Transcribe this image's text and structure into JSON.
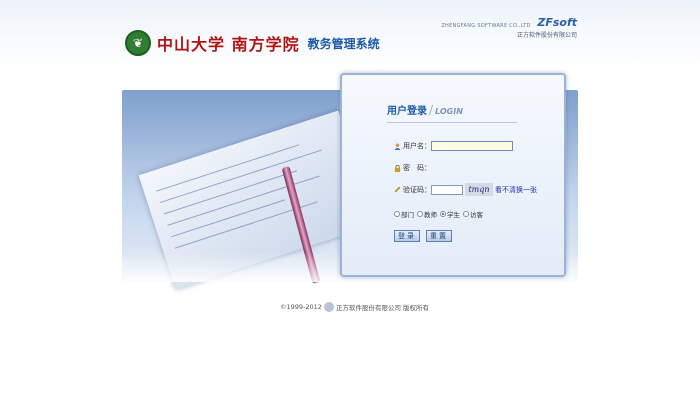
{
  "header": {
    "emblem_glyph": "❦",
    "university": "中山大学 南方学院",
    "system": "教务管理系统",
    "brand_en": "ZHENGFANG SOFTWARE CO.,LTD",
    "brand_logo": "ZFsoft",
    "brand_cn": "正方软件股份有限公司"
  },
  "login": {
    "title": "用户登录",
    "title_en": "LOGIN",
    "username_label": "用户名：",
    "username_value": "",
    "password_label": "密　码：",
    "captcha_label": "验证码：",
    "captcha_text": "tmqn",
    "refresh_text": "看不清换一张",
    "roles": [
      {
        "label": "部门",
        "checked": false
      },
      {
        "label": "教师",
        "checked": false
      },
      {
        "label": "学生",
        "checked": true
      },
      {
        "label": "访客",
        "checked": false
      }
    ],
    "login_button": "登录",
    "reset_button": "重置",
    "icons": {
      "user": "user-icon",
      "lock": "lock-icon",
      "pencil": "pencil-icon"
    }
  },
  "footer": {
    "copyright": "©1999-2012",
    "company": "正方软件股份有限公司 版权所有"
  }
}
